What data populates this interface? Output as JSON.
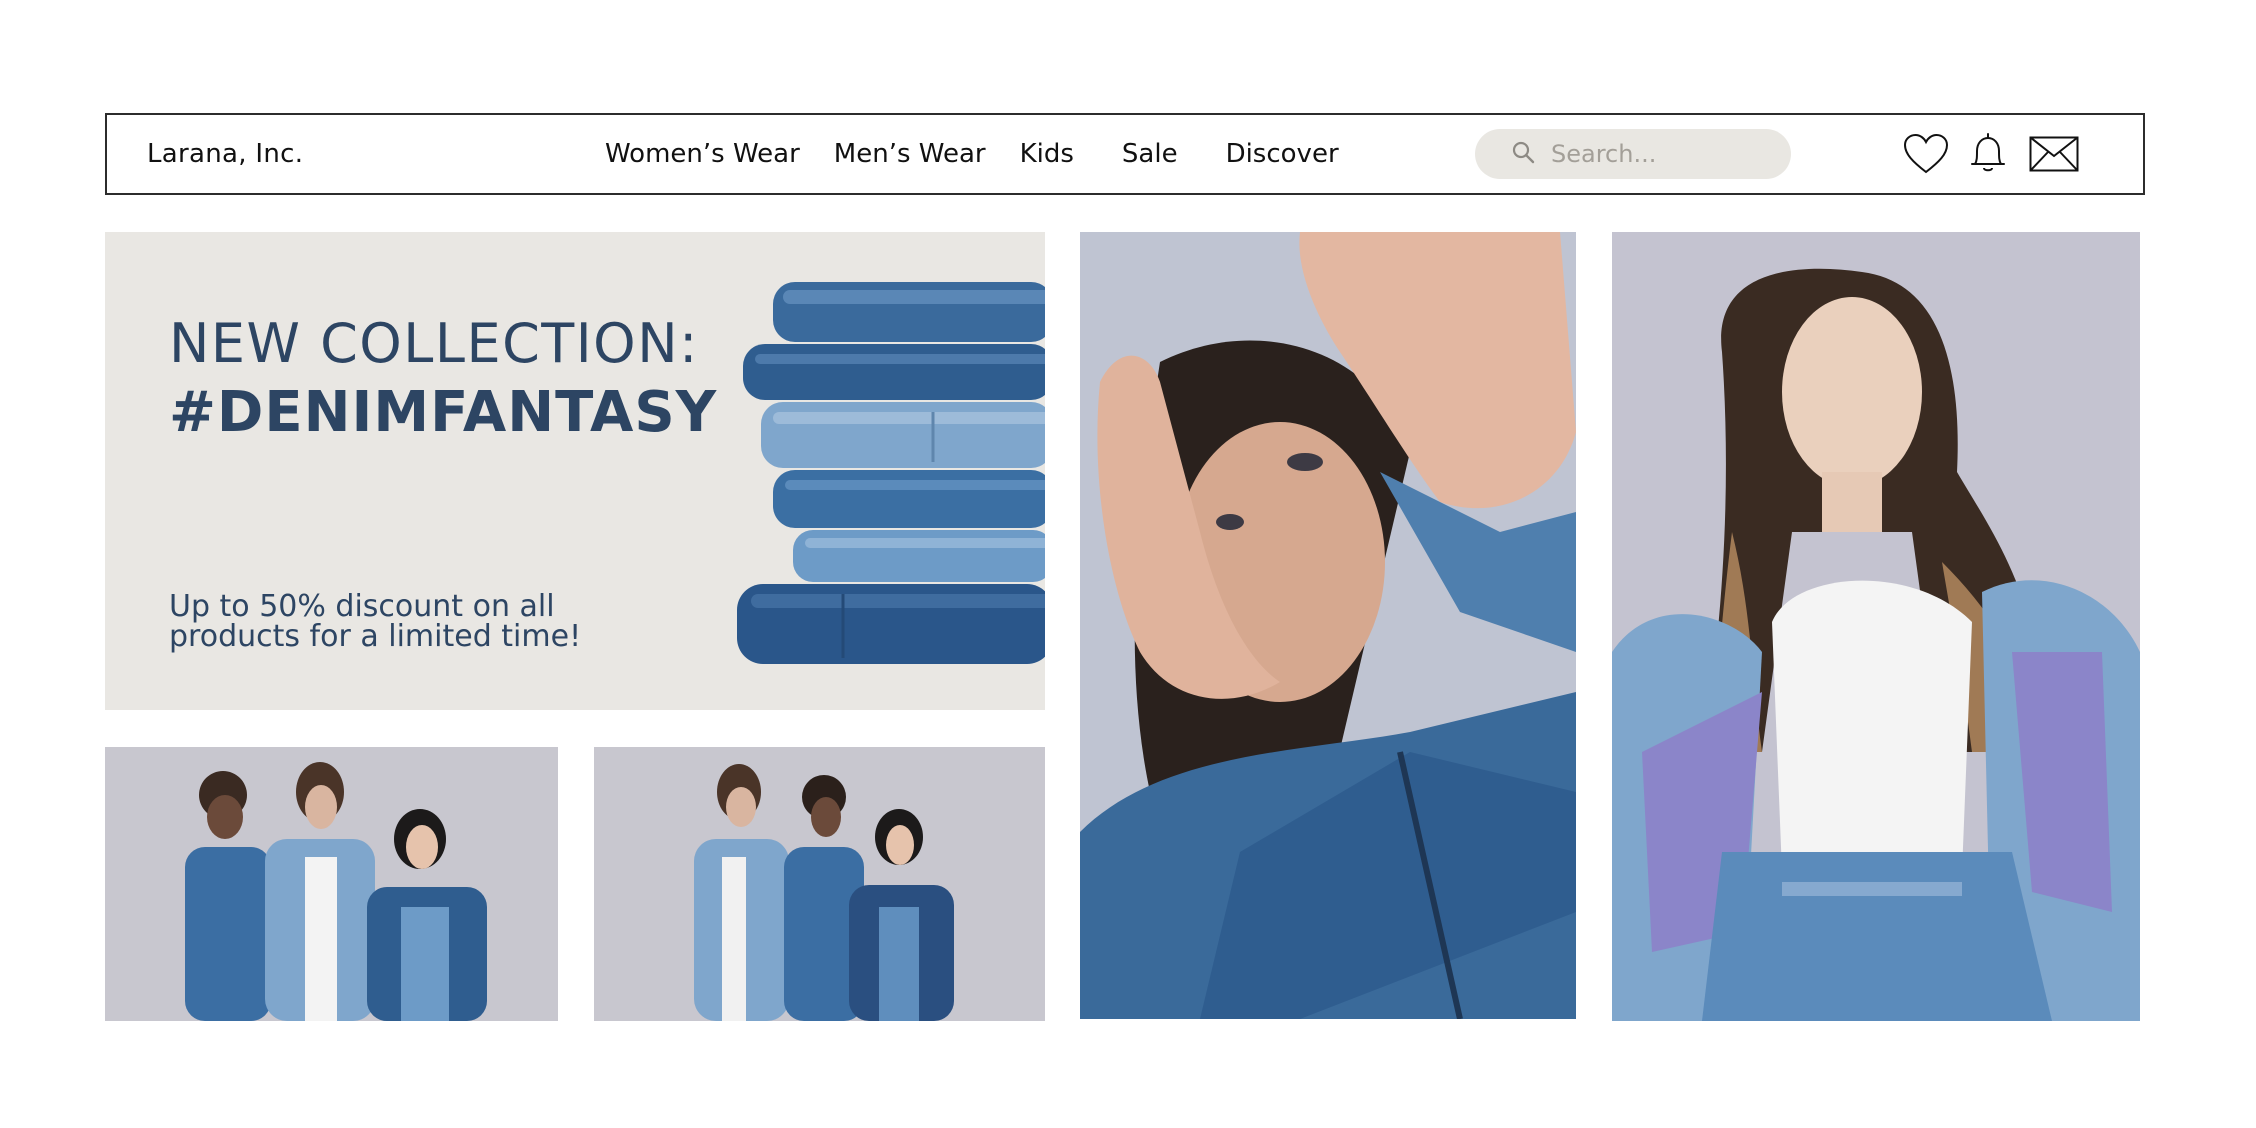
{
  "header": {
    "brand": "Larana, Inc.",
    "nav": [
      {
        "label": "Women’s Wear"
      },
      {
        "label": "Men’s Wear"
      },
      {
        "label": "Kids"
      },
      {
        "label": "Sale"
      },
      {
        "label": "Discover"
      }
    ],
    "search": {
      "placeholder": "Search..."
    },
    "icons": [
      "heart-icon",
      "bell-icon",
      "mail-icon"
    ]
  },
  "hero": {
    "title_line1": "NEW COLLECTION:",
    "title_line2": "#DENIMFANTASY",
    "subtitle_line1": "Up to 50% discount on all",
    "subtitle_line2": "products for a limited time!"
  },
  "colors": {
    "accent": "#2d4563",
    "hero_bg": "#e9e7e3",
    "search_bg": "#e9e7e2",
    "denim_dark": "#2f5d8f",
    "denim_light": "#7fa6cc"
  }
}
